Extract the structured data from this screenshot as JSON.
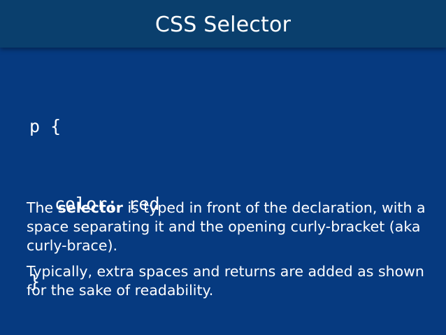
{
  "slide": {
    "title": "CSS Selector"
  },
  "code": {
    "line1": "p {",
    "line2": "color: red",
    "line3": "}"
  },
  "text": {
    "p1_before": "The ",
    "p1_bold": "selector",
    "p1_after": " is typed in front of the declaration, with a space separating it and the opening curly-bracket (aka curly-brace).",
    "p2": "Typically, extra spaces and returns are added as shown for the sake of readability."
  },
  "colors": {
    "background": "#063a80",
    "title_bar": "#0a3f6d",
    "text": "#ffffff"
  }
}
